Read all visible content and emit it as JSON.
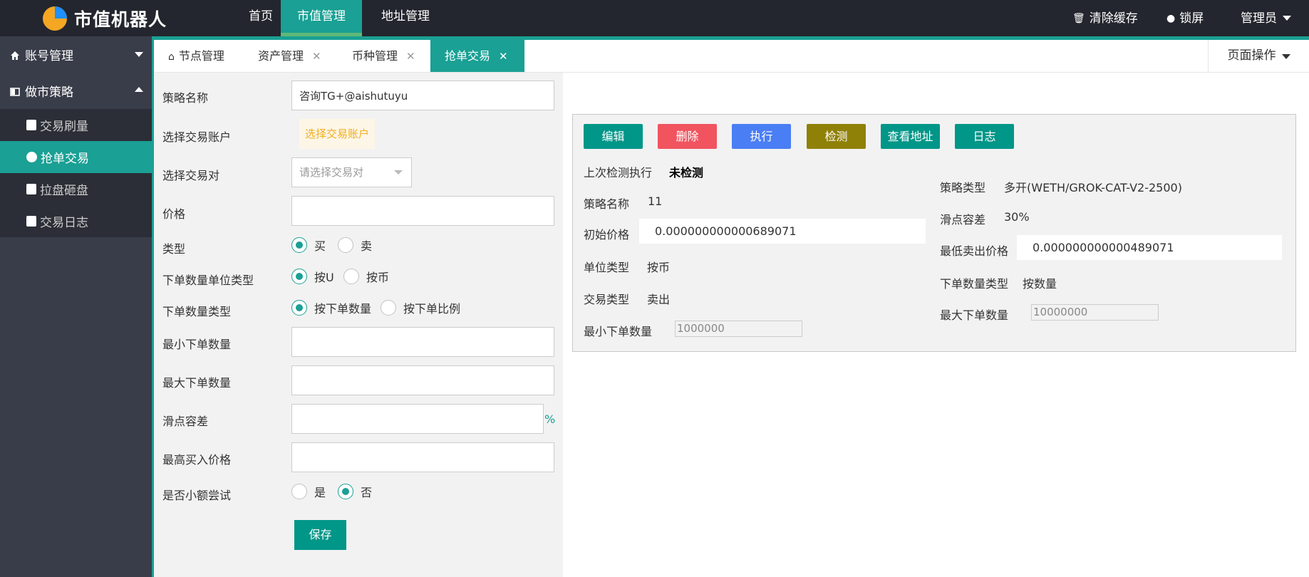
{
  "header": {
    "logo_text": "市值机器人",
    "nav": [
      "首页",
      "市值管理",
      "地址管理"
    ],
    "clear_cache": "清除缓存",
    "lock_screen": "锁屏",
    "admin": "管理员"
  },
  "sidebar": {
    "group1": "账号管理",
    "group2": "做市策略",
    "items": [
      "交易刷量",
      "抢单交易",
      "拉盘砸盘",
      "交易日志"
    ]
  },
  "tabs": [
    "节点管理",
    "资产管理",
    "币种管理",
    "抢单交易"
  ],
  "page_ops": "页面操作",
  "form": {
    "strategy_name_label": "策略名称",
    "strategy_name_value": "咨询TG+@aishutuyu",
    "account_label": "选择交易账户",
    "account_button": "选择交易账户",
    "pair_label": "选择交易对",
    "pair_placeholder": "请选择交易对",
    "price_label": "价格",
    "type_label": "类型",
    "type_buy": "买",
    "type_sell": "卖",
    "unit_type_label": "下单数量单位类型",
    "unit_u": "按U",
    "unit_coin": "按币",
    "qty_type_label": "下单数量类型",
    "qty_by_amount": "按下单数量",
    "qty_by_ratio": "按下单比例",
    "min_qty_label": "最小下单数量",
    "max_qty_label": "最大下单数量",
    "slippage_label": "滑点容差",
    "slippage_unit": "%",
    "max_buy_price_label": "最高买入价格",
    "small_try_label": "是否小额尝试",
    "yes": "是",
    "no": "否",
    "save": "保存"
  },
  "actions": {
    "edit": "编辑",
    "delete": "删除",
    "execute": "执行",
    "check": "检测",
    "view_address": "查看地址",
    "log": "日志",
    "colors": {
      "teal": "#009688",
      "red": "#f1545f",
      "blue": "#4a7ef4",
      "olive": "#8f8008"
    }
  },
  "detail": {
    "last_check_label": "上次检测执行",
    "last_check_value": "未检测",
    "strategy_type_label": "策略类型",
    "strategy_type_value": "多开(WETH/GROK-CAT-V2-2500)",
    "name_label": "策略名称",
    "name_value": "11",
    "slippage_label": "滑点容差",
    "slippage_value": "30%",
    "init_price_label": "初始价格",
    "init_price_value": "0.000000000000689071",
    "min_sell_label": "最低卖出价格",
    "min_sell_value": "0.000000000000489071",
    "unit_type_label": "单位类型",
    "unit_type_value": "按币",
    "qty_type_label": "下单数量类型",
    "qty_type_value": "按数量",
    "trade_type_label": "交易类型",
    "trade_type_value": "卖出",
    "max_qty_label": "最大下单数量",
    "max_qty_value": "10000000",
    "min_qty_label": "最小下单数量",
    "min_qty_value": "1000000"
  }
}
